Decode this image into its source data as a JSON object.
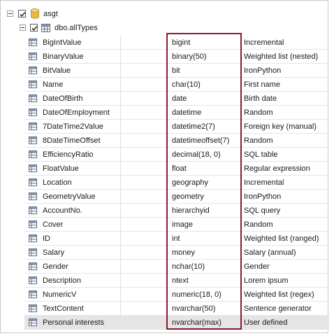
{
  "tree": {
    "database": {
      "name": "asgt",
      "checked": true,
      "expanded": true
    },
    "table": {
      "name": "dbo.allTypes",
      "checked": true,
      "expanded": true
    }
  },
  "columns": [
    {
      "name": "BigIntValue",
      "type": "bigint",
      "generator": "Incremental"
    },
    {
      "name": "BinaryValue",
      "type": "binary(50)",
      "generator": "Weighted list (nested)"
    },
    {
      "name": "BitValue",
      "type": "bit",
      "generator": "IronPython"
    },
    {
      "name": "Name",
      "type": "char(10)",
      "generator": "First name"
    },
    {
      "name": "DateOfBirth",
      "type": "date",
      "generator": "Birth date"
    },
    {
      "name": "DateOfEmployment",
      "type": "datetime",
      "generator": "Random"
    },
    {
      "name": "7DateTime2Value",
      "type": "datetime2(7)",
      "generator": "Foreign key (manual)"
    },
    {
      "name": "8DateTimeOffset",
      "type": "datetimeoffset(7)",
      "generator": "Random"
    },
    {
      "name": "EfficiencyRatio",
      "type": "decimal(18, 0)",
      "generator": "SQL table"
    },
    {
      "name": "FloatValue",
      "type": "float",
      "generator": "Regular expression"
    },
    {
      "name": "Location",
      "type": "geography",
      "generator": "Incremental"
    },
    {
      "name": "GeometryValue",
      "type": "geometry",
      "generator": "IronPython"
    },
    {
      "name": "AccountNo.",
      "type": "hierarchyid",
      "generator": "SQL query"
    },
    {
      "name": "Cover",
      "type": "image",
      "generator": "Random"
    },
    {
      "name": "ID",
      "type": "int",
      "generator": "Weighted list (ranged)"
    },
    {
      "name": "Salary",
      "type": "money",
      "generator": "Salary (annual)"
    },
    {
      "name": "Gender",
      "type": "nchar(10)",
      "generator": "Gender"
    },
    {
      "name": "Description",
      "type": "ntext",
      "generator": "Lorem ipsum"
    },
    {
      "name": "NumericV",
      "type": "numeric(18, 0)",
      "generator": "Weighted list (regex)"
    },
    {
      "name": "TextContent",
      "type": "nvarchar(50)",
      "generator": "Sentence generator"
    },
    {
      "name": "Personal interests",
      "type": "nvarchar(max)",
      "generator": "User defined",
      "selected": true
    }
  ],
  "colors": {
    "highlight_border": "#8b1a2c",
    "selected_row": "#e5e5e5",
    "db_icon": "#e8b84a"
  }
}
